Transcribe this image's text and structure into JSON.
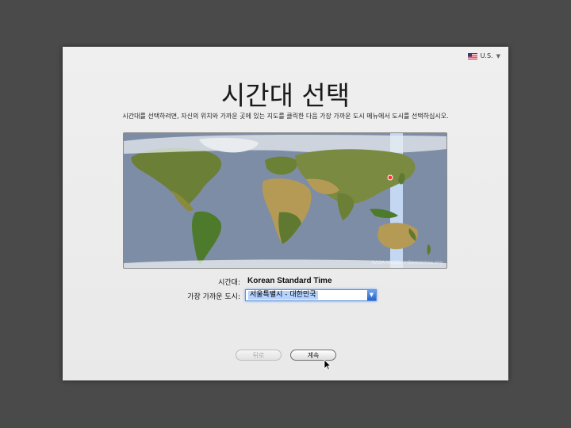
{
  "language_menu": {
    "label": "U.S.",
    "icon": "us-flag-icon"
  },
  "title": "시간대 선택",
  "instructions": "시간대를 선택하려면, 자신의 위치와 가까운 곳에 있는 지도를 클릭한 다음 가장 가까운 도시 메뉴에서 도시를 선택하십시오.",
  "map": {
    "credit": "NASA Visible... Geonames.org"
  },
  "timezone": {
    "label": "시간대:",
    "value": "Korean Standard Time"
  },
  "closest_city": {
    "label": "가장 가까운 도시:",
    "value": "서울특별시 - 대한민국"
  },
  "buttons": {
    "back": "뒤로",
    "continue": "계속"
  },
  "colors": {
    "ocean": "#7e8da6",
    "land": "#5f7a30",
    "desert": "#b59a55",
    "ice": "#e8ecef",
    "timezone_band": "#cfe3ff",
    "select_focus": "#5d8fd6"
  }
}
